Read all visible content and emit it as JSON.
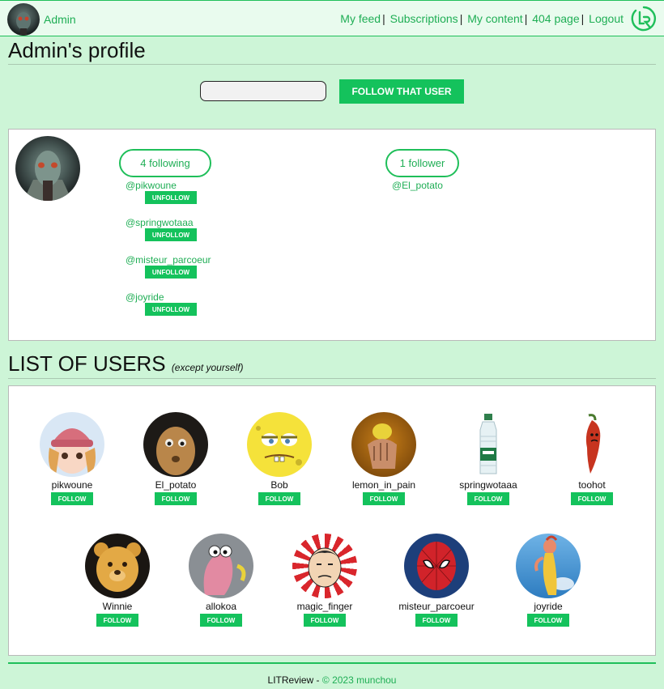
{
  "header": {
    "username": "Admin",
    "nav": [
      "My feed",
      "Subscriptions",
      "My content",
      "404 page",
      "Logout"
    ],
    "logo_icon": "lr-logo-icon"
  },
  "profile": {
    "title": "Admin's profile",
    "follow_button": "FOLLOW THAT USER",
    "following_label": "4 following",
    "follower_label": "1 follower",
    "following": [
      {
        "handle": "@pikwoune",
        "action": "UNFOLLOW"
      },
      {
        "handle": "@springwotaaa",
        "action": "UNFOLLOW"
      },
      {
        "handle": "@misteur_parcoeur",
        "action": "UNFOLLOW"
      },
      {
        "handle": "@joyride",
        "action": "UNFOLLOW"
      }
    ],
    "followers": [
      "@El_potato"
    ]
  },
  "users_section": {
    "title": "LIST OF USERS",
    "subtitle": "(except yourself)",
    "users": [
      {
        "name": "pikwoune",
        "action": "FOLLOW"
      },
      {
        "name": "El_potato",
        "action": "FOLLOW"
      },
      {
        "name": "Bob",
        "action": "FOLLOW"
      },
      {
        "name": "lemon_in_pain",
        "action": "FOLLOW"
      },
      {
        "name": "springwotaaa",
        "action": "FOLLOW"
      },
      {
        "name": "toohot",
        "action": "FOLLOW"
      },
      {
        "name": "Winnie",
        "action": "FOLLOW"
      },
      {
        "name": "allokoa",
        "action": "FOLLOW"
      },
      {
        "name": "magic_finger",
        "action": "FOLLOW"
      },
      {
        "name": "misteur_parcoeur",
        "action": "FOLLOW"
      },
      {
        "name": "joyride",
        "action": "FOLLOW"
      }
    ]
  },
  "footer": {
    "brand": "LITReview",
    "separator": " - ",
    "copyright": "© 2023 munchou"
  },
  "colors": {
    "accent": "#14c25c",
    "link": "#1fae55",
    "page_bg": "#cdf5d7"
  }
}
